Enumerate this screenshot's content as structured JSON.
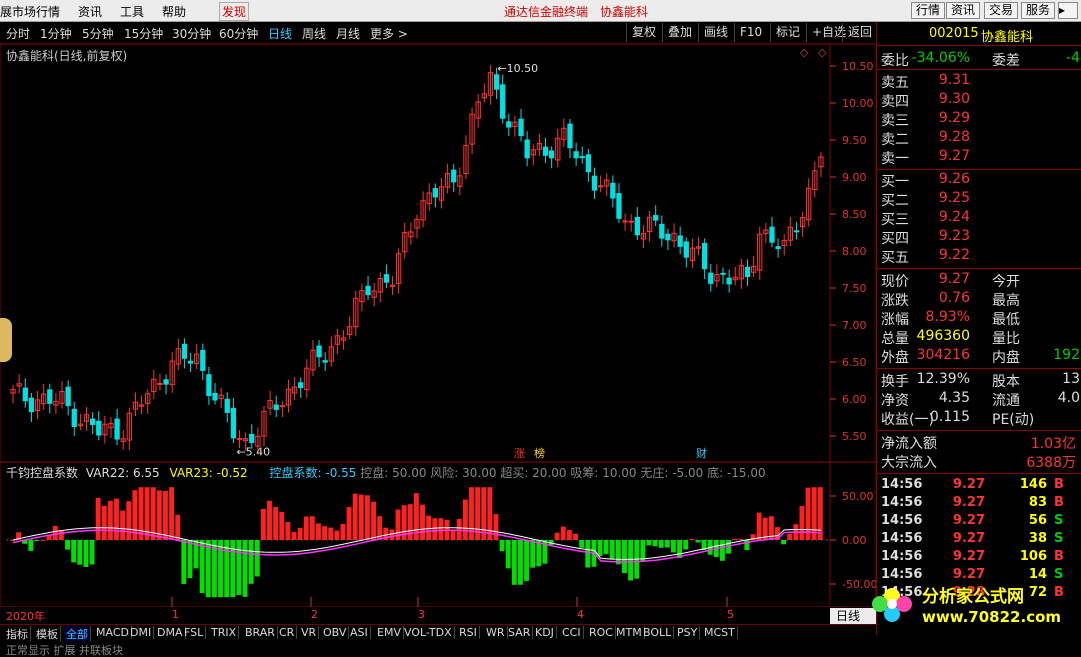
{
  "menu": {
    "items": [
      "展市场行情",
      "资讯",
      "工具",
      "帮助",
      "发现"
    ],
    "center_title": "通达信金融终端",
    "center_stock": "协鑫能科",
    "right_buttons": [
      "行情",
      "资讯",
      "交易",
      "服务"
    ]
  },
  "toolbar": {
    "periods": [
      "分时",
      "1分钟",
      "5分钟",
      "15分钟",
      "30分钟",
      "60分钟",
      "日线",
      "周线",
      "月线",
      "更多 >"
    ],
    "active_period": "日线",
    "buttons": [
      "复权",
      "叠加",
      "画线",
      "F10",
      "标记",
      "+自选",
      "返回"
    ]
  },
  "chart": {
    "title": "协鑫能科(日线,前复权)",
    "high_label": "10.50",
    "low_label": "5.40",
    "y_ticks": [
      "10.50",
      "10.00",
      "9.50",
      "9.00",
      "8.50",
      "8.00",
      "7.50",
      "7.00",
      "6.50",
      "6.00",
      "5.50"
    ],
    "sub_ticks": [
      "50.00",
      "0.00",
      "-50.00"
    ],
    "markers": [
      "涨",
      "榜",
      "财"
    ],
    "x_labels": [
      "2020年",
      "1",
      "2",
      "3",
      "4",
      "5"
    ]
  },
  "indicator": {
    "name": "千钧控盘系数",
    "var22": "VAR22: 6.55",
    "var23": "VAR23: -0.52",
    "kp": "控盘系数: -0.55",
    "rest": "  控盘: 50.00  风险: 30.00  超买: 20.00  吸筹: 10.00  无庄: -5.00  底: -15.00"
  },
  "colors": {
    "up": "#ff3333",
    "down": "#00e0e0",
    "bar_up": "#ff2020",
    "bar_down": "#00e000",
    "accent": "#33ccff"
  },
  "quote": {
    "code": "002015",
    "name": "协鑫能科",
    "weibi_label": "委比",
    "weibi": "-34.06%",
    "weicha_label": "委差",
    "weicha": "-4",
    "sells": [
      {
        "label": "卖五",
        "price": "9.31"
      },
      {
        "label": "卖四",
        "price": "9.30"
      },
      {
        "label": "卖三",
        "price": "9.29"
      },
      {
        "label": "卖二",
        "price": "9.28"
      },
      {
        "label": "卖一",
        "price": "9.27"
      }
    ],
    "buys": [
      {
        "label": "买一",
        "price": "9.26"
      },
      {
        "label": "买二",
        "price": "9.25"
      },
      {
        "label": "买三",
        "price": "9.24"
      },
      {
        "label": "买四",
        "price": "9.23"
      },
      {
        "label": "买五",
        "price": "9.22"
      }
    ],
    "stats": [
      {
        "l1": "现价",
        "v1": "9.27",
        "c1": "red",
        "l2": "今开",
        "v2": ""
      },
      {
        "l1": "涨跌",
        "v1": "0.76",
        "c1": "red",
        "l2": "最高",
        "v2": ""
      },
      {
        "l1": "涨幅",
        "v1": "8.93%",
        "c1": "red",
        "l2": "最低",
        "v2": ""
      },
      {
        "l1": "总量",
        "v1": "496360",
        "c1": "yellow",
        "l2": "量比",
        "v2": ""
      },
      {
        "l1": "外盘",
        "v1": "304216",
        "c1": "red",
        "l2": "内盘",
        "v2": "192"
      }
    ],
    "stats2": [
      {
        "l1": "换手",
        "v1": "12.39%",
        "l2": "股本",
        "v2": "13"
      },
      {
        "l1": "净资",
        "v1": "4.35",
        "l2": "流通",
        "v2": "4.0"
      },
      {
        "l1": "收益(一)",
        "v1": "0.115",
        "l2": "PE(动)",
        "v2": ""
      }
    ],
    "flow": [
      {
        "label": "净流入额",
        "value": "1.03亿"
      },
      {
        "label": "大宗流入",
        "value": "6388万"
      }
    ],
    "ticks": [
      {
        "t": "14:56",
        "p": "9.27",
        "v": "146",
        "s": "B"
      },
      {
        "t": "14:56",
        "p": "9.27",
        "v": "83",
        "s": "B"
      },
      {
        "t": "14:56",
        "p": "9.27",
        "v": "56",
        "s": "S"
      },
      {
        "t": "14:56",
        "p": "9.27",
        "v": "38",
        "s": "S"
      },
      {
        "t": "14:56",
        "p": "9.27",
        "v": "106",
        "s": "B"
      },
      {
        "t": "14:56",
        "p": "9.27",
        "v": "14",
        "s": "S"
      },
      {
        "t": "14:56",
        "p": "9.28",
        "v": "72",
        "s": "B"
      }
    ]
  },
  "bottom_tabs": [
    "指标",
    "模板",
    "全部",
    "MACD",
    "DMI",
    "DMA",
    "FSL",
    "TRIX",
    "BRAR",
    "CR",
    "VR",
    "OBV",
    "ASI",
    "EMV",
    "VOL-TDX",
    "RSI",
    "WR",
    "SAR",
    "KDJ",
    "CCI",
    "ROC",
    "MTM",
    "BOLL",
    "PSY",
    "MCST"
  ],
  "active_tab": "全部",
  "axis_button": "日线",
  "status_text": "正常显示  扩展  并联板块",
  "watermark": {
    "title": "分析家公式网",
    "url": "www.70822.com"
  }
}
